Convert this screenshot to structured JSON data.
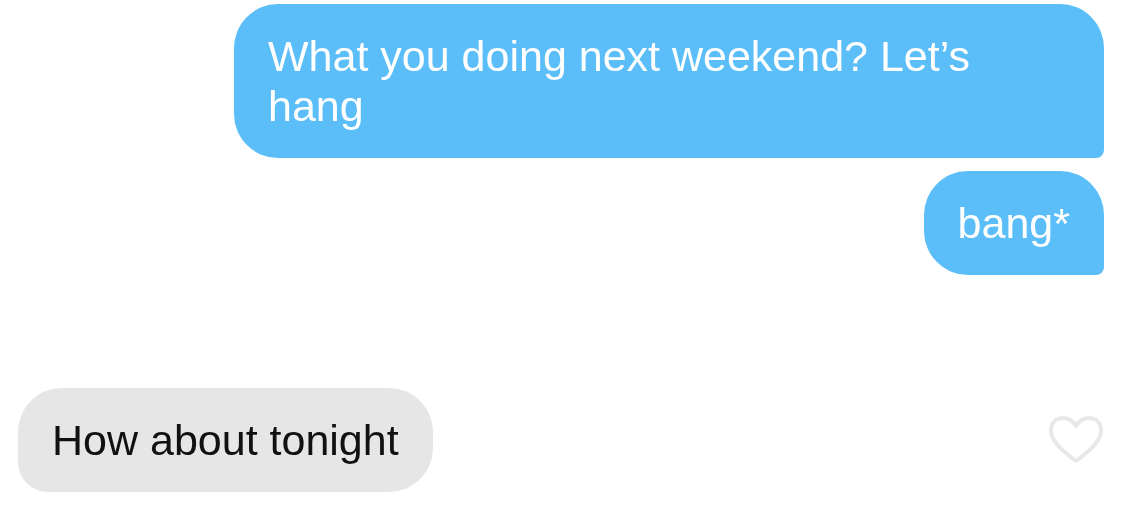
{
  "messages": [
    {
      "kind": "outgoing",
      "text": "What you doing next weekend? Let’s hang"
    },
    {
      "kind": "outgoing",
      "text": "bang*"
    },
    {
      "kind": "incoming",
      "text": "How about tonight",
      "liked": false
    }
  ]
}
